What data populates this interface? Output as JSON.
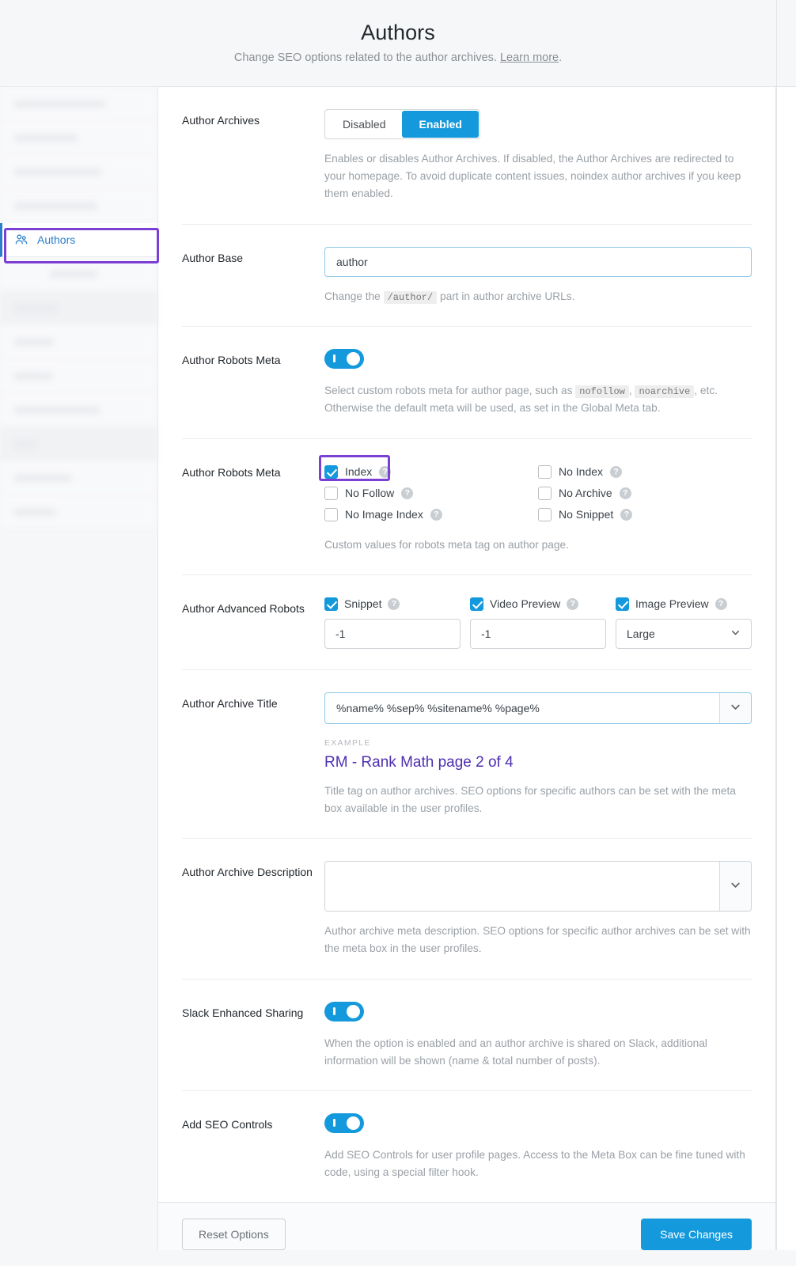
{
  "header": {
    "title": "Authors",
    "subtitle_prefix": "Change SEO options related to the author archives. ",
    "link_label": "Learn more",
    "subtitle_suffix": "."
  },
  "sidebar": {
    "active_item": {
      "label": "Authors",
      "icon": "users-icon"
    },
    "items_above": [
      {
        "blurred": true,
        "group": false
      },
      {
        "blurred": true,
        "group": false
      },
      {
        "blurred": true,
        "group": false
      },
      {
        "blurred": true,
        "group": false
      }
    ],
    "items_below": [
      {
        "blurred": true,
        "group": false
      },
      {
        "blurred": true,
        "group": true
      },
      {
        "blurred": true,
        "group": false
      },
      {
        "blurred": true,
        "group": false
      },
      {
        "blurred": true,
        "group": false
      },
      {
        "blurred": true,
        "group": true
      },
      {
        "blurred": true,
        "group": false
      },
      {
        "blurred": true,
        "group": false
      }
    ]
  },
  "colors": {
    "accent_blue": "#1499dd",
    "highlight_purple": "#7b3fd4",
    "link_purple": "#4e2fb0",
    "muted_text": "#9aa0a6"
  },
  "rows": {
    "author_archives": {
      "label": "Author Archives",
      "options": [
        "Disabled",
        "Enabled"
      ],
      "selected": "Enabled",
      "description": "Enables or disables Author Archives. If disabled, the Author Archives are redirected to your homepage. To avoid duplicate content issues, noindex author archives if you keep them enabled."
    },
    "author_base": {
      "label": "Author Base",
      "value": "author",
      "placeholder": "",
      "desc_before": "Change the ",
      "desc_code": "/author/",
      "desc_after": " part in author archive URLs."
    },
    "author_robots_meta_toggle": {
      "label": "Author Robots Meta",
      "toggle_state": "on",
      "desc_part1": "Select custom robots meta for author page, such as ",
      "desc_code1": "nofollow",
      "desc_part2": ", ",
      "desc_code2": "noarchive",
      "desc_part3": ", etc. Otherwise the default meta will be used, as set in the Global Meta tab."
    },
    "author_robots_meta_checks": {
      "label": "Author Robots Meta",
      "left_column": [
        {
          "label": "Index",
          "checked": true,
          "help": "?"
        },
        {
          "label": "No Follow",
          "checked": false,
          "help": "?"
        },
        {
          "label": "No Image Index",
          "checked": false,
          "help": "?"
        }
      ],
      "right_column": [
        {
          "label": "No Index",
          "checked": false,
          "help": "?"
        },
        {
          "label": "No Archive",
          "checked": false,
          "help": "?"
        },
        {
          "label": "No Snippet",
          "checked": false,
          "help": "?"
        }
      ],
      "description": "Custom values for robots meta tag on author page."
    },
    "author_advanced_robots": {
      "label": "Author Advanced Robots",
      "fields": [
        {
          "label": "Snippet",
          "checked": true,
          "help": "?",
          "type": "input",
          "value": "-1"
        },
        {
          "label": "Video Preview",
          "checked": true,
          "help": "?",
          "type": "input",
          "value": "-1"
        },
        {
          "label": "Image Preview",
          "checked": true,
          "help": "?",
          "type": "select",
          "value": "Large"
        }
      ]
    },
    "author_archive_title": {
      "label": "Author Archive Title",
      "value": "%name% %sep% %sitename% %page%",
      "example_label": "EXAMPLE",
      "example_text": "RM - Rank Math page 2 of 4",
      "description": "Title tag on author archives. SEO options for specific authors can be set with the meta box available in the user profiles."
    },
    "author_archive_description": {
      "label": "Author Archive Description",
      "value": "",
      "placeholder": "",
      "description": "Author archive meta description. SEO options for specific author archives can be set with the meta box in the user profiles."
    },
    "slack_enhanced_sharing": {
      "label": "Slack Enhanced Sharing",
      "toggle_state": "on",
      "description": "When the option is enabled and an author archive is shared on Slack, additional information will be shown (name & total number of posts)."
    },
    "add_seo_controls": {
      "label": "Add SEO Controls",
      "toggle_state": "on",
      "description": "Add SEO Controls for user profile pages. Access to the Meta Box can be fine tuned with code, using a special filter hook."
    }
  },
  "footer": {
    "reset_label": "Reset Options",
    "save_label": "Save Changes"
  }
}
